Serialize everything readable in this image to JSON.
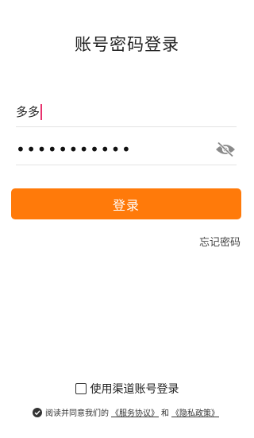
{
  "page": {
    "title": "账号密码登录"
  },
  "username": {
    "value": "多多"
  },
  "password": {
    "masked": "•••••••••••"
  },
  "login_button": {
    "label": "登录"
  },
  "forgot_password": {
    "label": "忘记密码"
  },
  "channel_login": {
    "label": "使用渠道账号登录",
    "checked": false
  },
  "agreement": {
    "prefix": "阅读并同意我们的",
    "service_link": "《服务协议》",
    "conjunction": "和",
    "privacy_link": "《隐私政策》",
    "checked": true
  },
  "icons": {
    "password_toggle": "eye-off-icon",
    "agreement_check": "check-circle-icon"
  },
  "colors": {
    "accent": "#ff7a0a",
    "caret": "#e8336e"
  }
}
